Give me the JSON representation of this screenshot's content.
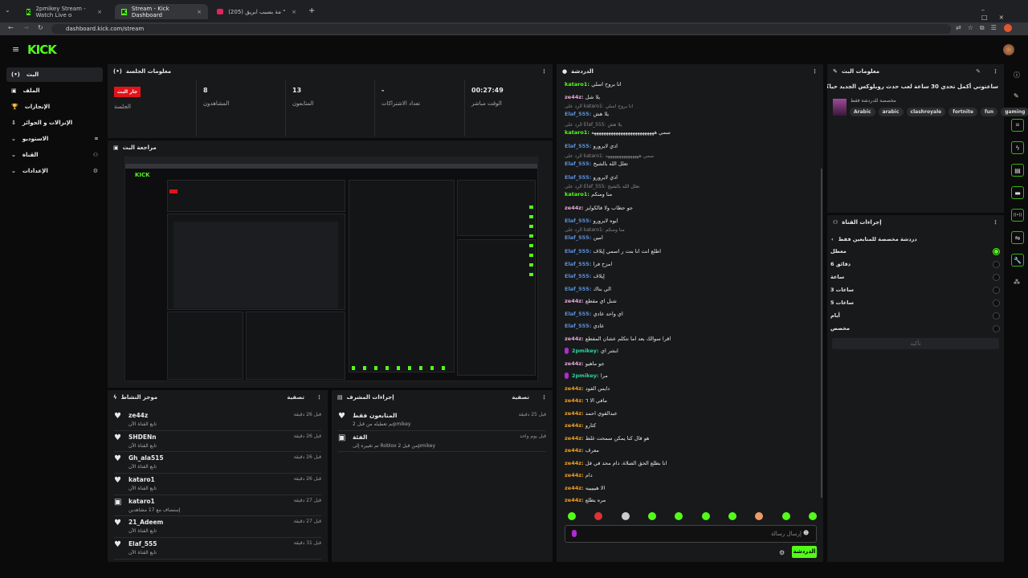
{
  "browser": {
    "tabs": [
      {
        "title": "2pmikey Stream - Watch Live o",
        "favicon": "kick"
      },
      {
        "title": "Stream - Kick Dashboard",
        "favicon": "kick",
        "active": true
      },
      {
        "title": "(205) جري \" مة بسبب ابريق",
        "favicon": "youtube"
      }
    ],
    "url": "dashboard.kick.com/stream"
  },
  "header": {
    "logo": "KICK"
  },
  "sidebar": {
    "items": [
      {
        "label": "البث",
        "icon": "broadcast-icon",
        "active": true
      },
      {
        "label": "الملف",
        "icon": "profile-icon"
      },
      {
        "label": "الإنجازات",
        "icon": "trophy-icon"
      },
      {
        "label": "الإنزالات و الجوائز",
        "icon": "drops-icon"
      },
      {
        "label": "الاستوديو",
        "icon": "studio-icon",
        "expandable": true
      },
      {
        "label": "القناة",
        "icon": "channel-icon",
        "expandable": true
      },
      {
        "label": "الإعدادات",
        "icon": "gear-icon",
        "expandable": true
      }
    ]
  },
  "session": {
    "title": "معلومات الجلسة",
    "live_badge": "جار البث",
    "stats": [
      {
        "value": "",
        "label": "الجلسة"
      },
      {
        "value": "8",
        "label": "المشاهدون"
      },
      {
        "value": "13",
        "label": "المتابعون"
      },
      {
        "value": "-",
        "label": "تعداد الاشتراكات"
      },
      {
        "value": "00:27:49",
        "label": "الوقت مباشر"
      }
    ]
  },
  "preview": {
    "title": "مراجعة البث"
  },
  "activity": {
    "title": "موجز النشاط",
    "filter": "تصفية",
    "items": [
      {
        "name": "ze44z",
        "sub": "تابع القناة الآن",
        "time": "قبل 26 دقيقة",
        "icon": "heart-icon"
      },
      {
        "name": "SHDENn",
        "sub": "تابع القناة الآن",
        "time": "قبل 26 دقيقة",
        "icon": "heart-icon"
      },
      {
        "name": "Gh_ala515",
        "sub": "تابع القناة الآن",
        "time": "قبل 26 دقيقة",
        "icon": "heart-icon"
      },
      {
        "name": "kataro1",
        "sub": "تابع القناة الآن",
        "time": "قبل 26 دقيقة",
        "icon": "heart-icon"
      },
      {
        "name": "kataro1",
        "sub": "إستضاف مع 17 مشاهدين",
        "time": "قبل 27 دقيقة",
        "icon": "host-icon"
      },
      {
        "name": "21_Adeem",
        "sub": "تابع القناة الآن",
        "time": "قبل 27 دقيقة",
        "icon": "heart-icon"
      },
      {
        "name": "Elaf_555",
        "sub": "تابع القناة الآن",
        "time": "قبل 31 دقيقة",
        "icon": "heart-icon"
      }
    ]
  },
  "mod": {
    "title": "إجراءات المشرف",
    "filter": "تصفية",
    "items": [
      {
        "name": "المتابعون فقط",
        "sub": "تم تعطيله من قبل 2pmikey",
        "time": "قبل 25 دقيقة",
        "icon": "heart-icon"
      },
      {
        "name": "الفئة",
        "sub": "تم تغييره إلى Roblox من قبل 2pmikey",
        "time": "قبل يوم واحد",
        "icon": "category-icon"
      }
    ]
  },
  "chat": {
    "title": "الدردشة",
    "placeholder": "إرسال رسالة",
    "send_label": "الدردشة",
    "colors": {
      "kataro1": "#53fc18",
      "ze44z_pink": "#e7a9d6",
      "Elaf_555": "#5b8fd6",
      "2pmikey": "#2fd4a0",
      "ze44z_orange": "#f0a020"
    },
    "messages": [
      {
        "user": "kataro1",
        "color": "#53fc18",
        "text": "انا بروح اسلي"
      },
      {
        "user": "ze44z",
        "color": "#e7a9d6",
        "text": "يلا شل"
      },
      {
        "reply": "الرد على kataro1: انا بروح اسلي",
        "user": "Elaf_555",
        "color": "#5b8fd6",
        "text": "يلا هش"
      },
      {
        "reply": "الرد على Elaf_555: يلا هش",
        "user": "kataro1",
        "color": "#53fc18",
        "text": "سمي ههههههههههههههههههههههههههه"
      },
      {
        "user": "Elaf_555",
        "color": "#5b8fd6",
        "text": "ادي لايرورو"
      },
      {
        "reply": "الرد على kataro1: سمي هههههههههههههههه",
        "user": "Elaf_555",
        "color": "#5b8fd6",
        "text": "تعلل الله بالشيخ"
      },
      {
        "user": "Elaf_555",
        "color": "#5b8fd6",
        "text": "ادي لايرورو"
      },
      {
        "reply": "الرد على Elaf_555: تعلل الله بالشيخ",
        "user": "kataro1",
        "color": "#53fc18",
        "text": "منا ومنكم"
      },
      {
        "user": "ze44z",
        "color": "#e7a9d6",
        "text": "جو حطاب ولا فالكوايز"
      },
      {
        "user": "Elaf_555",
        "color": "#5b8fd6",
        "text": "ايوه لايرورو"
      },
      {
        "reply": "الرد على kataro1: منا ومنكم",
        "user": "Elaf_555",
        "color": "#5b8fd6",
        "text": "امين"
      },
      {
        "user": "Elaf_555",
        "color": "#5b8fd6",
        "text": "اطلع انت انا بنت ر اسمي إيلاف"
      },
      {
        "user": "Elaf_555",
        "color": "#5b8fd6",
        "text": "امزح فرا"
      },
      {
        "user": "Elaf_555",
        "color": "#5b8fd6",
        "text": "إيلاف"
      },
      {
        "user": "Elaf_555",
        "color": "#5b8fd6",
        "text": "الي بناك"
      },
      {
        "user": "ze44z",
        "color": "#e7a9d6",
        "text": "شنل اي مقطع"
      },
      {
        "user": "Elaf_555",
        "color": "#5b8fd6",
        "text": "اي واحد عادي"
      },
      {
        "user": "Elaf_555",
        "color": "#5b8fd6",
        "text": "عادي"
      },
      {
        "user": "ze44z",
        "color": "#e7a9d6",
        "text": "اقرا سوالك بعد اما نتكلم عشان المقطع"
      },
      {
        "user": "2pmikey",
        "color": "#2fd4a0",
        "badge": true,
        "text": "ابشر اي"
      },
      {
        "user": "ze44z",
        "color": "#e7a9d6",
        "text": "جو ماهيو"
      },
      {
        "user": "2pmikey",
        "color": "#2fd4a0",
        "badge": true,
        "text": "مرا"
      },
      {
        "user": "ze44z",
        "color": "#f0a020",
        "text": "دايس القود"
      },
      {
        "user": "ze44z",
        "color": "#f0a020",
        "text": "مافي الا ٦"
      },
      {
        "user": "ze44z",
        "color": "#f0a020",
        "text": "عبدالقوي احمد"
      },
      {
        "user": "ze44z",
        "color": "#f0a020",
        "text": "كثارو"
      },
      {
        "user": "ze44z",
        "color": "#f0a020",
        "text": "هو قال كنا يمكن سمحت غلط"
      },
      {
        "user": "ze44z",
        "color": "#f0a020",
        "text": "معرف"
      },
      {
        "user": "ze44z",
        "color": "#f0a020",
        "text": "انا بطلع الحق الصلاة، دام محد في قل"
      },
      {
        "user": "ze44z",
        "color": "#f0a020",
        "text": "دام"
      },
      {
        "user": "ze44z",
        "color": "#f0a020",
        "text": "الا هيييييه"
      },
      {
        "user": "ze44z",
        "color": "#f0a020",
        "text": "مره يطلع"
      }
    ]
  },
  "stream_info": {
    "title": "معلومات البث",
    "stream_title": "ساعتوني أكمل تحدي 30 ساعة لعب حدث روبلوكس الجديد حياكم الله 🌝 30/20",
    "category": "مخصصة للدردشة فقط",
    "tags": [
      "Arabic",
      "arabic",
      "clashroyale",
      "fortnite",
      "fun",
      "gaming"
    ]
  },
  "channel_actions": {
    "title": "إجراءات القناة",
    "subtitle": "دردشة مخصصة للمتابعين فقط",
    "options": [
      "معطل",
      "6 دقائق",
      "ساعة",
      "3 ساعات",
      "5 ساعات",
      "أيام",
      "مخصص"
    ],
    "selected": 0,
    "confirm": "تأكيد"
  },
  "accent": "#53fc18"
}
